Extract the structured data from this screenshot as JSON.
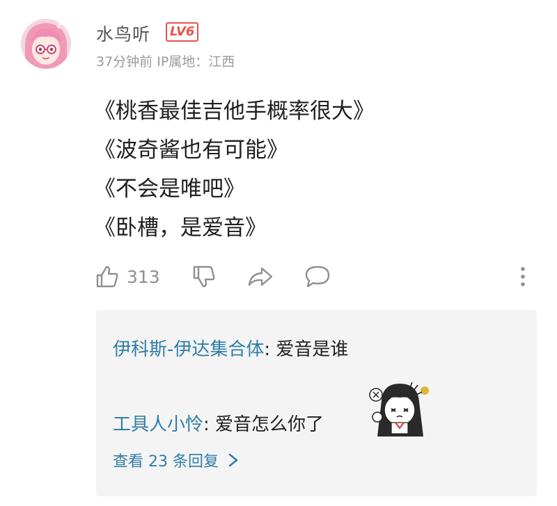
{
  "comment": {
    "username": "水鸟听",
    "level": "LV6",
    "meta": "37分钟前 IP属地：江西",
    "lines": [
      "《桃香最佳吉他手概率很大》",
      "《波奇酱也有可能》",
      "《不会是唯吧》",
      "《卧槽，是爱音》"
    ],
    "like_count": "313",
    "icons": [
      "thumbs-up-icon",
      "thumbs-down-icon",
      "share-icon",
      "comment-icon",
      "more-icon"
    ],
    "accent_color": "#2f7ea8",
    "level_color": "#e8524c"
  },
  "replies": [
    {
      "author": "伊科斯-伊达集合体",
      "text": ": 爱音是谁"
    },
    {
      "author": "工具人小怜",
      "text": ": 爱音怎么你了"
    }
  ],
  "view_more": "查看 23 条回复"
}
